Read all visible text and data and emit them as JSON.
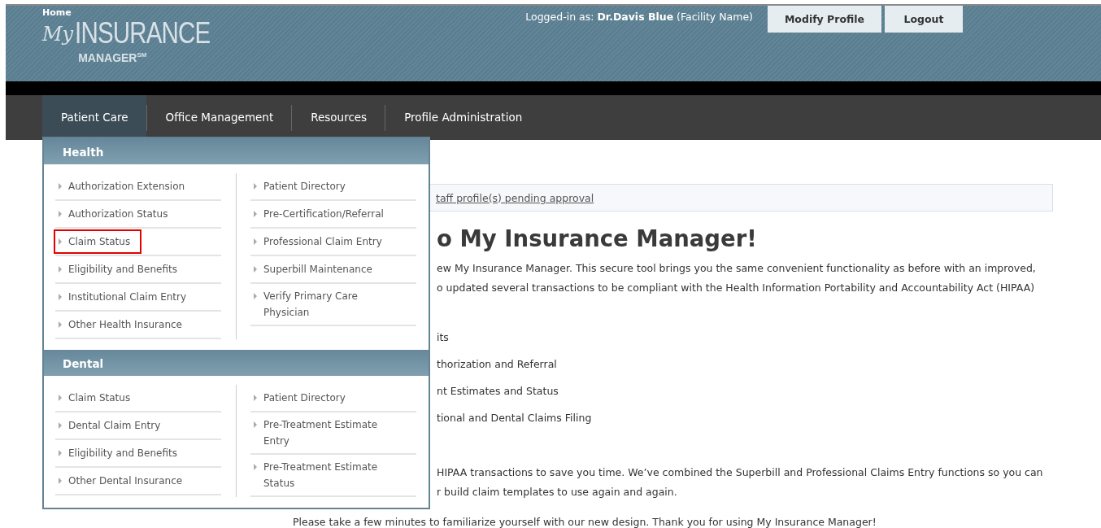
{
  "header": {
    "home_link": "Home",
    "logo": {
      "script": "My",
      "main": "INSURANCE",
      "sub": "MANAGER",
      "mark": "SM"
    },
    "login_label": "Logged-in as:",
    "user_name": "Dr.Davis Blue",
    "facility": "(Facility Name)",
    "buttons": [
      "Modify Profile",
      "Logout"
    ]
  },
  "nav": {
    "tabs": [
      {
        "label": "Patient Care",
        "selected": true
      },
      {
        "label": "Office Management",
        "selected": false
      },
      {
        "label": "Resources",
        "selected": false
      },
      {
        "label": "Profile Administration",
        "selected": false
      }
    ]
  },
  "menu": {
    "sections": [
      {
        "title": "Health",
        "columns": [
          [
            {
              "label": "Authorization Extension",
              "highlighted": false
            },
            {
              "label": "Authorization Status",
              "highlighted": false
            },
            {
              "label": "Claim Status",
              "highlighted": true
            },
            {
              "label": "Eligibility and Benefits",
              "highlighted": false
            },
            {
              "label": "Institutional Claim Entry",
              "highlighted": false
            },
            {
              "label": "Other Health Insurance",
              "highlighted": false
            }
          ],
          [
            {
              "label": "Patient Directory",
              "highlighted": false
            },
            {
              "label": "Pre-Certification/Referral",
              "highlighted": false
            },
            {
              "label": "Professional Claim Entry",
              "highlighted": false
            },
            {
              "label": "Superbill Maintenance",
              "highlighted": false
            },
            {
              "label": "Verify Primary Care Physician",
              "highlighted": false
            }
          ]
        ]
      },
      {
        "title": "Dental",
        "columns": [
          [
            {
              "label": "Claim Status",
              "highlighted": false
            },
            {
              "label": "Dental Claim Entry",
              "highlighted": false
            },
            {
              "label": "Eligibility and Benefits",
              "highlighted": false
            },
            {
              "label": "Other Dental Insurance",
              "highlighted": false
            }
          ],
          [
            {
              "label": "Patient Directory",
              "highlighted": false
            },
            {
              "label": "Pre-Treatment Estimate\nEntry",
              "highlighted": false
            },
            {
              "label": "Pre-Treatment Estimate\nStatus",
              "highlighted": false
            }
          ]
        ]
      }
    ]
  },
  "content": {
    "notice_link": "taff profile(s) pending approval",
    "heading": "o My Insurance Manager!",
    "intro_lines": [
      "ew My Insurance Manager. This secure tool brings you the same convenient functionality as before with an improved,",
      "o updated several transactions to be compliant with the Health Information Portability and Accountability Act (HIPAA)"
    ],
    "list": [
      "its",
      "thorization and Referral",
      "nt Estimates and Status",
      "tional and Dental Claims Filing"
    ],
    "outro_lines": [
      "HIPAA transactions to save you time. We’ve combined the Superbill and Professional Claims Entry functions so you can",
      "r build claim templates to use again and again."
    ],
    "closing": "Please take a few minutes to familiarize yourself with our new design. Thank you for using My Insurance Manager!"
  }
}
